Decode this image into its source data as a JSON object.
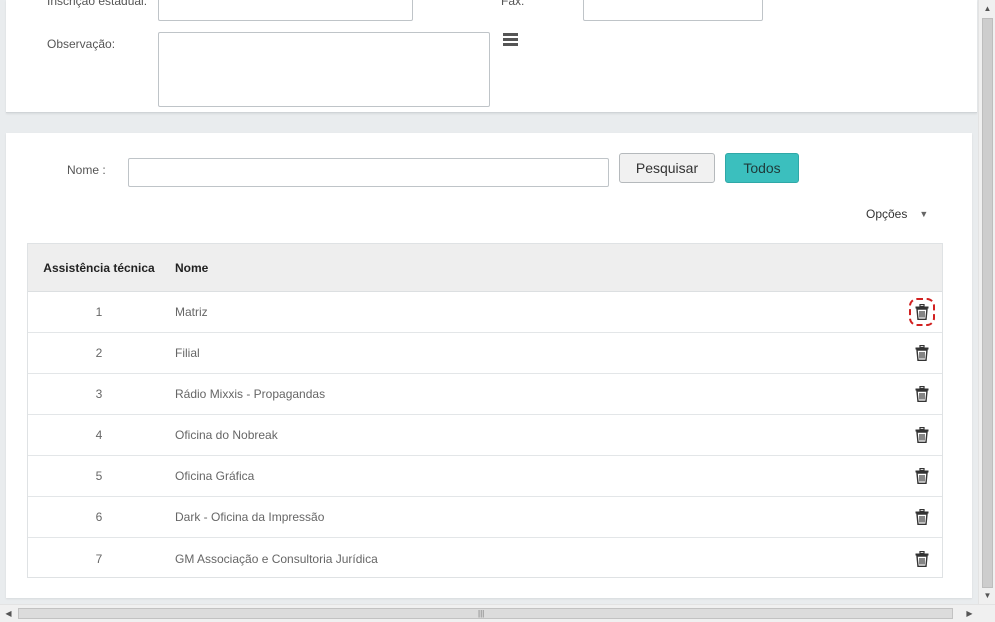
{
  "top_form": {
    "inscricao_label": "Inscrição estadual:",
    "fax_label": "Fax:",
    "observacao_label": "Observação:"
  },
  "search": {
    "label": "Nome :",
    "value": "",
    "search_button": "Pesquisar",
    "all_button": "Todos"
  },
  "options": {
    "label": "Opções",
    "caret": "▼"
  },
  "table": {
    "headers": {
      "id": "Assistência técnica",
      "name": "Nome"
    },
    "rows": [
      {
        "id": "1",
        "name": "Matriz"
      },
      {
        "id": "2",
        "name": "Filial"
      },
      {
        "id": "3",
        "name": "Rádio Mixxis - Propagandas"
      },
      {
        "id": "4",
        "name": "Oficina do Nobreak"
      },
      {
        "id": "5",
        "name": "Oficina Gráfica"
      },
      {
        "id": "6",
        "name": "Dark - Oficina da Impressão"
      },
      {
        "id": "7",
        "name": "GM Associação e Consultoria Jurídica"
      }
    ],
    "row_action_icon": "trash-icon"
  },
  "colors": {
    "accent": "#3bbfbe",
    "focus_outline": "#d12020",
    "page_background": "#e9ecee"
  }
}
